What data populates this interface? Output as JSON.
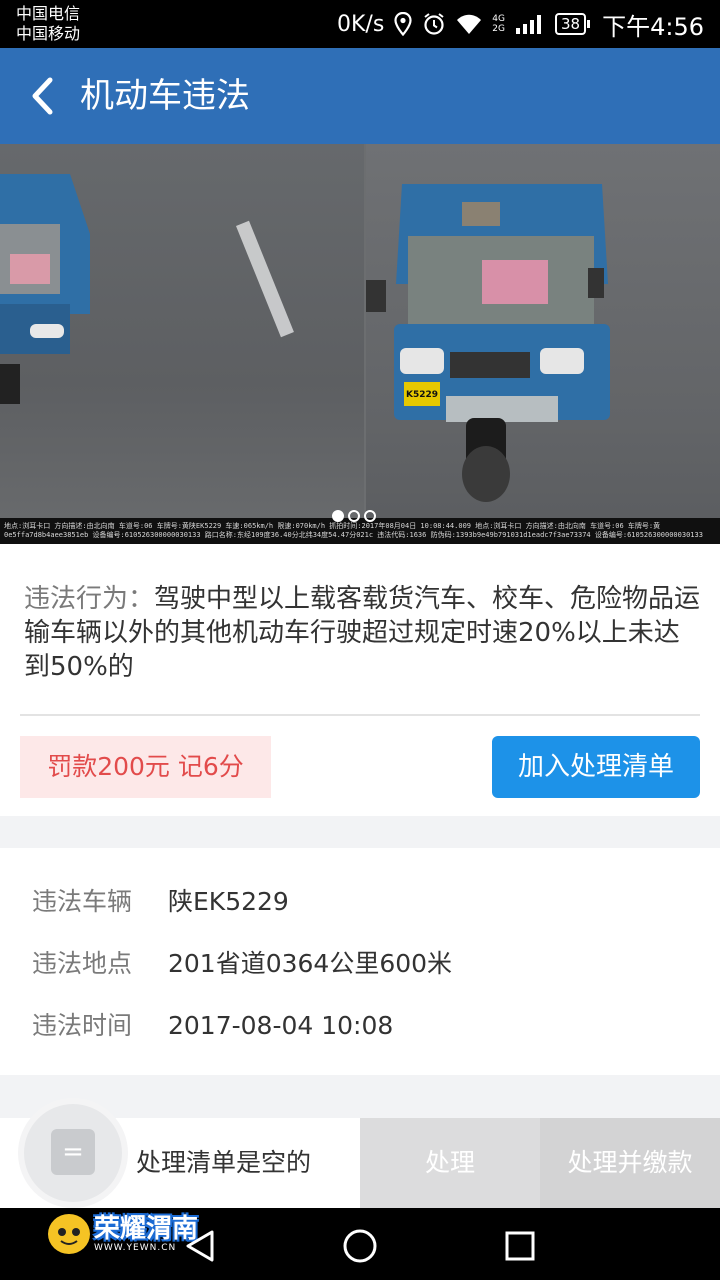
{
  "status_bar": {
    "carrier_1": "中国电信",
    "carrier_2": "中国移动",
    "net_speed": "0K/s",
    "net_1": "4G",
    "net_2": "2G",
    "battery": "38",
    "time": "下午4:56",
    "icons": [
      "location-icon",
      "alarm-icon",
      "wifi-icon",
      "signal-icon",
      "battery-icon"
    ]
  },
  "app_bar": {
    "title": "机动车违法",
    "back_icon": "chevron-left-icon"
  },
  "photo": {
    "page_count": 3,
    "active_page": 1,
    "plate_text": "K5229",
    "caption_line_1": "地点:浏耳卡口 方向描述:由北向南 车道号:06 车牌号:黄陕EK5229 车速:065km/h 限速:070km/h 抓拍时间:2017年08月04日 10:08:44.009 地点:浏耳卡口 方向描述:由北向南 车道号:06 车牌号:黄",
    "caption_line_2": "0e5ffa7d8b4aee3851eb 设备编号:610526300000030133 路口名称:东经109度36.40分北纬34度54.47分021c 违法代码:1636 防伪码:1393b9e49b791031d1eadc7f3ae73374 设备编号:610526300000030133"
  },
  "violation": {
    "label": "违法行为：",
    "text": "驾驶中型以上载客载货汽车、校车、危险物品运输车辆以外的其他机动车行驶超过规定时速20%以上未达到50%的",
    "penalty": "罚款200元 记6分",
    "add_button": "加入处理清单"
  },
  "details": [
    {
      "key": "违法车辆",
      "value": "陕EK5229"
    },
    {
      "key": "违法地点",
      "value": "201省道0364公里600米"
    },
    {
      "key": "违法时间",
      "value": "2017-08-04 10:08"
    }
  ],
  "bottom_bar": {
    "cart_glyph": "=",
    "empty_text": "处理清单是空的",
    "process_button": "处理",
    "process_pay_button": "处理并缴款"
  },
  "watermark": {
    "main": "荣耀渭南",
    "sub": "WWW.YEWN.CN"
  },
  "colors": {
    "app_bar": "#2f6fb7",
    "primary_button": "#1d92e8",
    "penalty_text": "#e24b4b",
    "penalty_bg": "#fde8e8"
  }
}
